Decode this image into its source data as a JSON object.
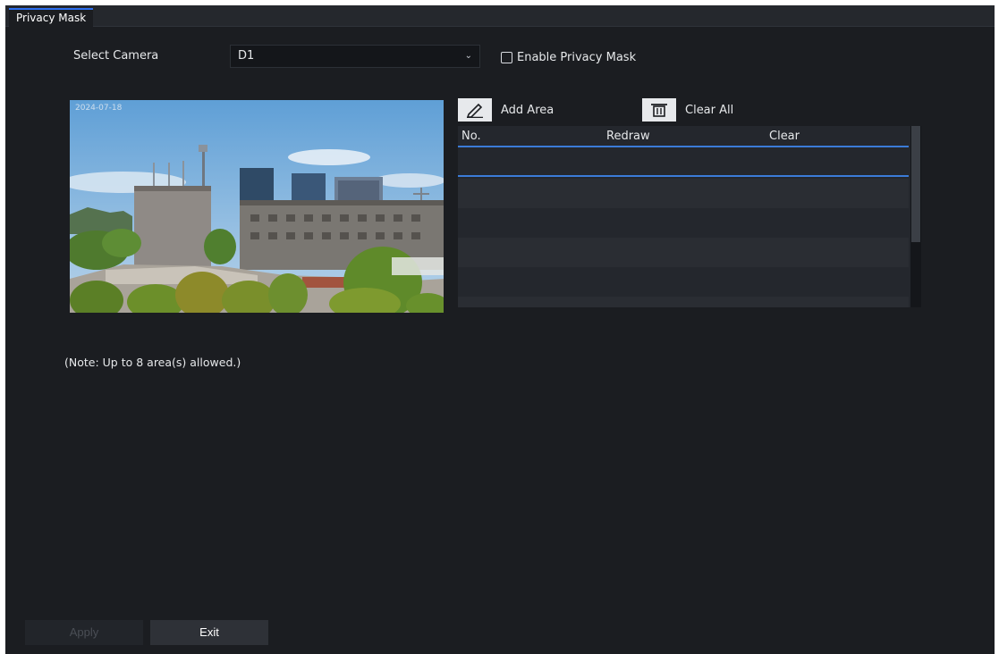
{
  "tabs": [
    {
      "label": "Privacy Mask",
      "active": true
    }
  ],
  "camera": {
    "label": "Select Camera",
    "selected": "D1"
  },
  "enable_mask": {
    "label": "Enable Privacy Mask",
    "checked": false
  },
  "preview": {
    "osd_text": "2024-07-18"
  },
  "toolbar": {
    "add_area_label": "Add Area",
    "add_area_icon": "pencil-icon",
    "clear_all_label": "Clear All",
    "clear_all_icon": "trash-icon"
  },
  "area_table": {
    "columns": [
      "No.",
      "Redraw",
      "Clear"
    ],
    "rows": []
  },
  "note": "(Note: Up to 8 area(s) allowed.)",
  "buttons": {
    "apply_label": "Apply",
    "apply_enabled": false,
    "exit_label": "Exit"
  },
  "colors": {
    "accent": "#3b7bd8",
    "background": "#1b1d21",
    "tab_active": "#2d6ff0"
  }
}
